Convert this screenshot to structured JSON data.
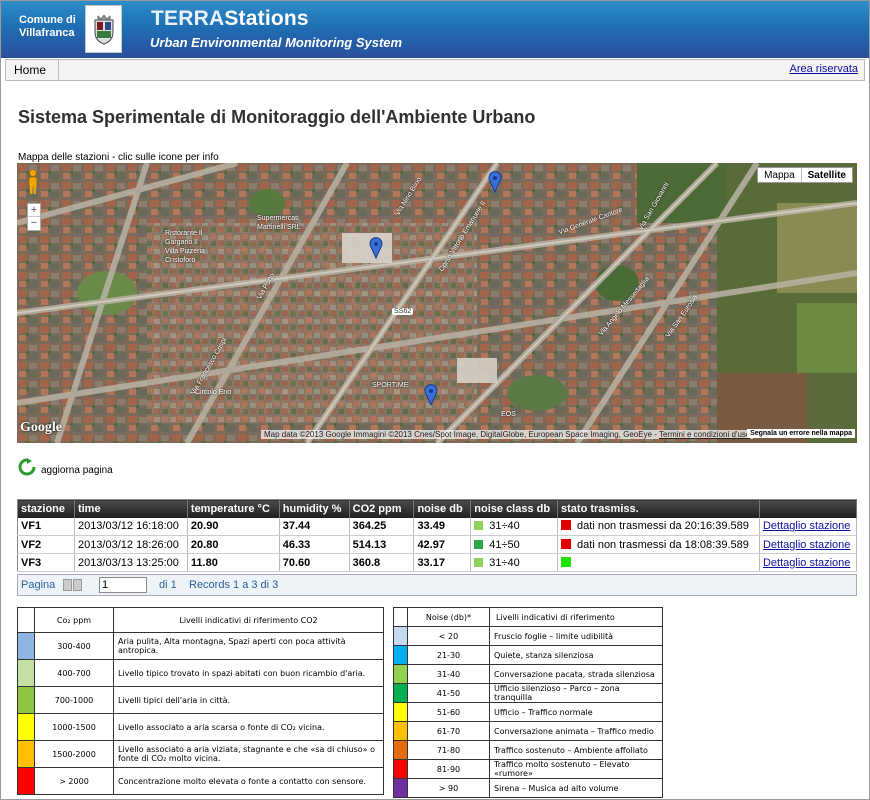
{
  "header": {
    "org_line1": "Comune di",
    "org_line2": "Villafranca",
    "brand_part1": "TERRA",
    "brand_part2": "Stations",
    "tagline": "Urban Environmental Monitoring System"
  },
  "nav": {
    "home": "Home",
    "reserved": "Area riservata"
  },
  "page_title": "Sistema Sperimentale di Monitoraggio dell'Ambiente Urbano",
  "map": {
    "caption": "Mappa delle stazioni - clic sulle icone per info",
    "type_map": "Mappa",
    "type_satellite": "Satellite",
    "zoom_in": "+",
    "zoom_out": "−",
    "logo": "Google",
    "credits": "Map data ©2013 Google Immagini ©2013 Cnes/Spot Image, DigitalGlobe, European Space Imaging, GeoEye -",
    "terms": "Termini e condizioni d'uso",
    "report_error": "Segnala un errore nella mappa",
    "labels": {
      "supermarket1": "Supermercati",
      "supermarket2": "Martinelli SRL",
      "rest1": "Ristorante Il",
      "rest2": "Gargano Il",
      "rest3": "Villa Pizzeria",
      "rest4": "Cristoforo",
      "circolo": "Circolo Eno",
      "sportime": "SPORTIME",
      "eos": "EOS",
      "shield": "SS62",
      "street1": "Via Nino Bixio",
      "street2": "Via Generale Cantore",
      "street3": "Corso Vittorio Emanuele II",
      "street4": "Via Angelo Messedaglia",
      "street5": "Via San Giovanni",
      "street6": "Via San Eurosia",
      "street7": "Via Porto",
      "street8": "Via Francesco Crispi"
    }
  },
  "refresh_label": "aggiorna pagina",
  "stations_table": {
    "headers": [
      "stazione",
      "time",
      "temperature °C",
      "humidity %",
      "CO2 ppm",
      "noise db",
      "noise class db",
      "stato trasmiss.",
      ""
    ],
    "rows": [
      {
        "station": "VF1",
        "time": "2013/03/12 16:18:00",
        "temperature": "20.90",
        "humidity": "37.44",
        "co2": "364.25",
        "noise": "33.49",
        "noise_class": "31÷40",
        "noise_color": "#8fd35a",
        "status_color": "#e00000",
        "status": "dati non trasmessi da 20:16:39.589",
        "link": "Dettaglio stazione"
      },
      {
        "station": "VF2",
        "time": "2013/03/12 18:26:00",
        "temperature": "20.80",
        "humidity": "46.33",
        "co2": "514.13",
        "noise": "42.97",
        "noise_class": "41÷50",
        "noise_color": "#2aa84a",
        "status_color": "#e00000",
        "status": "dati non trasmessi da 18:08:39.589",
        "link": "Dettaglio stazione"
      },
      {
        "station": "VF3",
        "time": "2013/03/13 13:25:00",
        "temperature": "11.80",
        "humidity": "70.60",
        "co2": "360.8",
        "noise": "33.17",
        "noise_class": "31÷40",
        "noise_color": "#8fd35a",
        "status_color": "#22e000",
        "status": "",
        "link": "Dettaglio stazione"
      }
    ]
  },
  "pager": {
    "label": "Pagina",
    "value": "1",
    "of": "di 1",
    "records": "Records 1 a 3 di 3"
  },
  "co2_legend": {
    "header_range": "Co₂ ppm",
    "header_desc": "Livelli  indicativi di riferimento CO2",
    "rows": [
      {
        "color": "#8db4e2",
        "range": "300-400",
        "desc": "Aria pulita, Alta montagna, Spazi aperti con poca attività antropica."
      },
      {
        "color": "#c3dfa2",
        "range": "400-700",
        "desc": "Livello tipico trovato in spazi abitati con buon ricambio d'aria."
      },
      {
        "color": "#8cc63f",
        "range": "700-1000",
        "desc": "Livelli tipici dell'aria in città."
      },
      {
        "color": "#ffff00",
        "range": "1000-1500",
        "desc": "Livello associato a aria scarsa o fonte di CO₂ vicina."
      },
      {
        "color": "#ffc000",
        "range": "1500-2000",
        "desc": "Livello associato a aria viziata, stagnante e che «sa di chiuso» o fonte di CO₂ molto vicina."
      },
      {
        "color": "#ff0000",
        "range": "> 2000",
        "desc": "Concentrazione molto elevata o fonte a contatto con sensore."
      }
    ]
  },
  "noise_legend": {
    "header_range": "Noise (db)*",
    "header_desc": "Livelli indicativi di riferimento",
    "rows": [
      {
        "color": "#c6d9f1",
        "range": "< 20",
        "desc": "Fruscio foglie – limite udibilità"
      },
      {
        "color": "#00b0f0",
        "range": "21-30",
        "desc": "Quiete, stanza silenziosa"
      },
      {
        "color": "#92d050",
        "range": "31-40",
        "desc": "Conversazione pacata, strada silenziosa"
      },
      {
        "color": "#00b050",
        "range": "41-50",
        "desc": "Ufficio silenzioso – Parco – zona tranquilla"
      },
      {
        "color": "#ffff00",
        "range": "51-60",
        "desc": "Ufficio – Traffico normale"
      },
      {
        "color": "#ffc000",
        "range": "61-70",
        "desc": "Conversazione animata – Traffico medio"
      },
      {
        "color": "#e46c0a",
        "range": "71-80",
        "desc": "Traffico sostenuto – Ambiente affollato"
      },
      {
        "color": "#ff0000",
        "range": "81-90",
        "desc": "Traffico molto sostenuto – Elevato «rumore»"
      },
      {
        "color": "#7030a0",
        "range": "> 90",
        "desc": "Sirena – Musica ad alto volume"
      }
    ]
  }
}
